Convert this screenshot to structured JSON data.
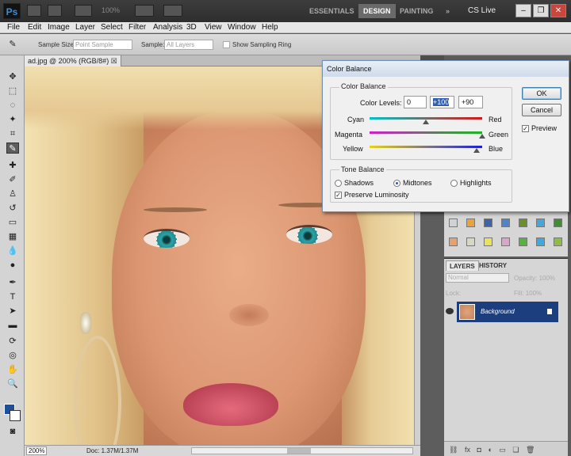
{
  "app": {
    "logo": "Ps",
    "zoom": "100%",
    "workspaces": [
      "ESSENTIALS",
      "DESIGN",
      "PAINTING"
    ],
    "active_workspace": "DESIGN",
    "more_glyph": "»",
    "cs_live": "CS Live"
  },
  "menu": [
    "File",
    "Edit",
    "Image",
    "Layer",
    "Select",
    "Filter",
    "Analysis",
    "3D",
    "View",
    "Window",
    "Help"
  ],
  "options": {
    "sample_size_label": "Sample Size:",
    "sample_size_value": "Point Sample",
    "sample_label": "Sample:",
    "sample_value": "All Layers",
    "show_ring": "Show Sampling Ring"
  },
  "document": {
    "tab": "ad.jpg @ 200% (RGB/8#)",
    "zoom": "200%",
    "doc_size": "Doc: 1.37M/1.37M"
  },
  "color_balance": {
    "title": "Color Balance",
    "group_label": "Color Balance",
    "levels_label": "Color Levels:",
    "levels": [
      "0",
      "+100",
      "+90"
    ],
    "sliders": [
      {
        "left": "Cyan",
        "right": "Red",
        "value": 0
      },
      {
        "left": "Magenta",
        "right": "Green",
        "value": 100
      },
      {
        "left": "Yellow",
        "right": "Blue",
        "value": 90
      }
    ],
    "tone_label": "Tone Balance",
    "tones": [
      "Shadows",
      "Midtones",
      "Highlights"
    ],
    "selected_tone": "Midtones",
    "preserve": "Preserve Luminosity",
    "ok": "OK",
    "cancel": "Cancel",
    "preview": "Preview"
  },
  "layers": {
    "tabs": [
      "LAYERS",
      "HISTORY"
    ],
    "blend_mode": "Normal",
    "opacity_label": "Opacity:",
    "opacity": "100%",
    "lock_label": "Lock:",
    "fill_label": "Fill:",
    "fill": "100%",
    "layer_name": "Background"
  },
  "colors": {
    "accent": "#1d3e7e",
    "eye_tint": "#2ba3a5"
  }
}
